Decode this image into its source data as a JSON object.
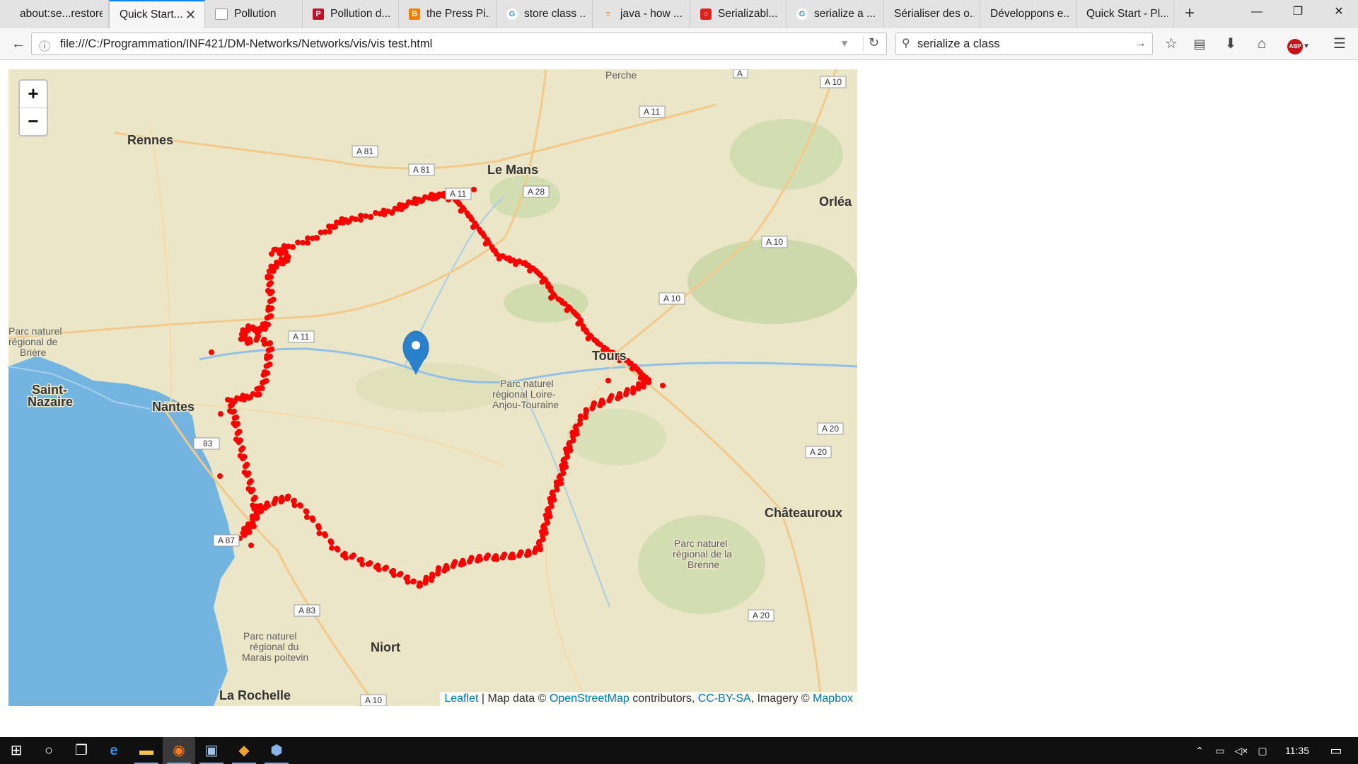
{
  "browser": {
    "tabs": [
      {
        "label": "about:se...restore",
        "icon": "blank-page-icon",
        "active": false
      },
      {
        "label": "Quick Start...",
        "icon": "blank-page-icon",
        "active": true
      },
      {
        "label": "Pollution",
        "icon": "page-icon",
        "active": false
      },
      {
        "label": "Pollution d...",
        "icon": "p-logo-icon",
        "active": false
      },
      {
        "label": "the Press Pi...",
        "icon": "blogger-icon",
        "active": false
      },
      {
        "label": "store class ...",
        "icon": "google-icon",
        "active": false
      },
      {
        "label": "java - how ...",
        "icon": "stackoverflow-icon",
        "active": false
      },
      {
        "label": "Serializabl...",
        "icon": "oracle-icon",
        "active": false
      },
      {
        "label": "serialize a ...",
        "icon": "google-icon",
        "active": false
      },
      {
        "label": "Sérialiser des o...",
        "icon": "blank-page-icon",
        "active": false
      },
      {
        "label": "Développons e...",
        "icon": "blank-page-icon",
        "active": false
      },
      {
        "label": "Quick Start - Pl...",
        "icon": "blank-page-icon",
        "active": false
      }
    ],
    "url": "file:///C:/Programmation/INF421/DM-Networks/Networks/vis/vis test.html",
    "search_value": "serialize a class",
    "accent": "#0a84ff"
  },
  "map": {
    "zoom_in_label": "+",
    "zoom_out_label": "−",
    "attribution": {
      "leaflet": "Leaflet",
      "sep": " | Map data © ",
      "osm": "OpenStreetMap",
      "contrib": " contributors, ",
      "license": "CC-BY-SA",
      "imagery": ", Imagery © ",
      "mapbox": "Mapbox"
    },
    "places": {
      "rennes": "Rennes",
      "le_mans": "Le Mans",
      "orleans": "Orléa",
      "nantes": "Nantes",
      "saint_nazaire_1": "Saint-",
      "saint_nazaire_2": "Nazaire",
      "tours": "Tours",
      "chateauroux": "Châteauroux",
      "niort": "Niort",
      "la_rochelle": "La Rochelle",
      "perche": "Perche",
      "briere_1": "Parc naturel",
      "briere_2": "régional de",
      "briere_3": "Brière",
      "loire_1": "Parc naturel",
      "loire_2": "régional Loire-",
      "loire_3": "Anjou-Touraine",
      "brenne_1": "Parc naturel",
      "brenne_2": "régional de la",
      "brenne_3": "Brenne",
      "marais_1": "Parc naturel",
      "marais_2": "régional du",
      "marais_3": "Marais poitevin"
    },
    "roads": {
      "a10_top": "A 10",
      "a11_top": "A 11",
      "a81_1": "A 81",
      "a81_2": "A 81",
      "a11_lm": "A 11",
      "a28": "A 28",
      "a10_orl": "A 10",
      "a10_mid": "A 10",
      "a11_w": "A 11",
      "a20_1": "A 20",
      "a20_2": "A 20",
      "a83_w": "83",
      "a87": "A 87",
      "a83_s": "A 83",
      "a20_s": "A 20",
      "a10_bot": "A 10",
      "a_top": "A"
    },
    "marker_color": "#2a81cb",
    "route_color": "#ff0000",
    "land_color": "#ece6c9",
    "water_color": "#74b4e0"
  },
  "taskbar": {
    "time": "11:35",
    "icons": [
      "windows-start-icon",
      "cortana-search-icon",
      "task-view-icon",
      "edge-icon",
      "file-explorer-icon",
      "firefox-icon",
      "photos-icon",
      "git-icon",
      "app-cube-icon"
    ]
  }
}
